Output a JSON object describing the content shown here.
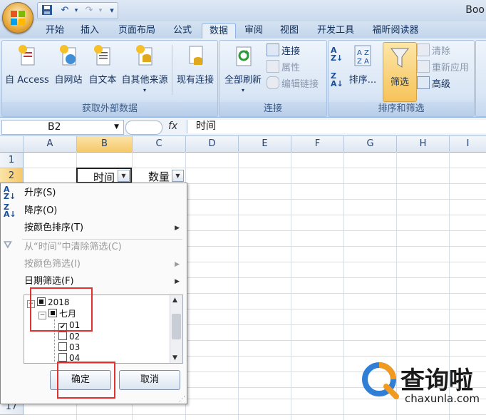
{
  "app": {
    "title_partial": "Boo"
  },
  "qat": {
    "save_icon": "save-icon",
    "undo_icon": "undo-icon",
    "redo_icon": "redo-icon",
    "customize": "▾"
  },
  "tabs": [
    {
      "label": "开始"
    },
    {
      "label": "插入"
    },
    {
      "label": "页面布局"
    },
    {
      "label": "公式"
    },
    {
      "label": "数据",
      "active": true
    },
    {
      "label": "审阅"
    },
    {
      "label": "视图"
    },
    {
      "label": "开发工具"
    },
    {
      "label": "福昕阅读器"
    }
  ],
  "ribbon": {
    "external": {
      "label": "获取外部数据",
      "access": "自 Access",
      "web": "自网站",
      "text": "自文本",
      "other": "自其他来源",
      "existing": "现有连接"
    },
    "connections": {
      "label": "连接",
      "refresh_all": "全部刷新",
      "connections": "连接",
      "properties": "属性",
      "edit_links": "编辑链接"
    },
    "sort_filter": {
      "label": "排序和筛选",
      "sort": "排序...",
      "filter": "筛选",
      "clear": "清除",
      "reapply": "重新应用",
      "advanced": "高级"
    }
  },
  "formula_bar": {
    "name_box": "B2",
    "fx": "fx",
    "formula": "时间"
  },
  "sheet": {
    "columns": [
      "A",
      "B",
      "C",
      "D",
      "E",
      "F",
      "G",
      "H",
      "I"
    ],
    "rows": [
      "1",
      "2",
      "17"
    ],
    "cells": {
      "B2": "时间",
      "C2": "数量"
    }
  },
  "filter_menu": {
    "sort_asc": "升序(S)",
    "sort_desc": "降序(O)",
    "sort_by_color": "按颜色排序(T)",
    "clear_filter": "从“时间”中清除筛选(C)",
    "filter_by_color": "按颜色筛选(I)",
    "date_filter": "日期筛选(F)",
    "tree": {
      "year": "2018",
      "month": "七月",
      "days": [
        {
          "label": "01",
          "checked": true
        },
        {
          "label": "02",
          "checked": false
        },
        {
          "label": "03",
          "checked": false
        },
        {
          "label": "04",
          "checked": false
        }
      ]
    },
    "ok": "确定",
    "cancel": "取消"
  },
  "watermark": {
    "brand": "查询啦",
    "domain": "chaxunla.com"
  }
}
